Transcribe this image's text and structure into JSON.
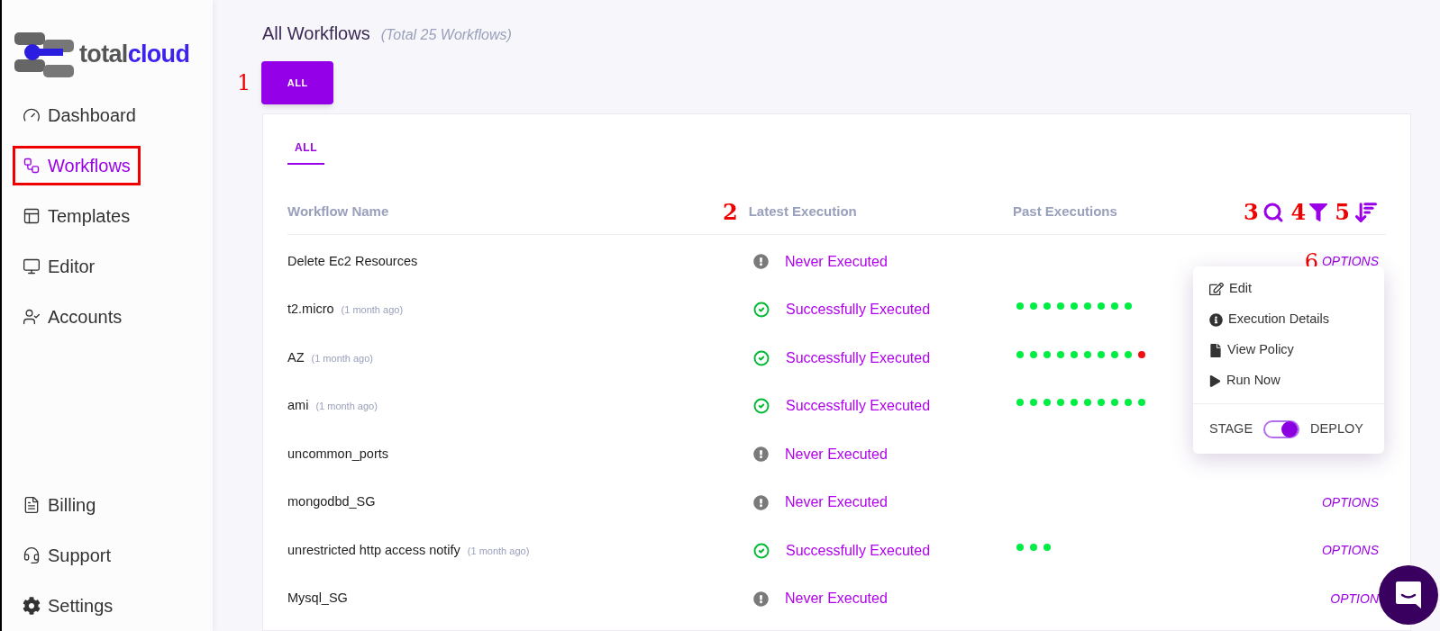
{
  "logo": {
    "part1": "total",
    "part2": "cloud"
  },
  "sidebar": {
    "items": [
      {
        "label": "Dashboard",
        "selected": false,
        "annotated": false
      },
      {
        "label": "Workflows",
        "selected": true,
        "annotated": true
      },
      {
        "label": "Templates",
        "selected": false,
        "annotated": false
      },
      {
        "label": "Editor",
        "selected": false,
        "annotated": false
      },
      {
        "label": "Accounts",
        "selected": false,
        "annotated": false
      }
    ],
    "bottom_items": [
      {
        "label": "Billing",
        "selected": false,
        "annotated": false
      },
      {
        "label": "Support",
        "selected": false,
        "annotated": false
      },
      {
        "label": "Settings",
        "selected": false,
        "annotated": false
      }
    ]
  },
  "header": {
    "title": "All Workflows",
    "subtitle": "(Total 25 Workflows)"
  },
  "filter_button": {
    "label": "ALL",
    "annotation": "1"
  },
  "tabs": [
    {
      "label": "ALL",
      "selected": true
    }
  ],
  "table": {
    "columns": [
      {
        "label": "Workflow Name"
      },
      {
        "label": "Latest Execution",
        "annotation": "2"
      },
      {
        "label": "Past Executions"
      }
    ],
    "tools": [
      {
        "kind": "search",
        "annotation": "3"
      },
      {
        "kind": "filter",
        "annotation": "4"
      },
      {
        "kind": "sort",
        "annotation": "5"
      }
    ],
    "rows": [
      {
        "name": "Delete Ec2 Resources",
        "kind": "never",
        "status_text": "Never Executed",
        "options": "OPTIONS",
        "annotation": "6"
      },
      {
        "name": "t2.micro",
        "age": "(1 month ago)",
        "kind": "success",
        "status_text": "Successfully Executed",
        "past": [
          {
            "color": "#00ee44"
          },
          {
            "color": "#00ee44"
          },
          {
            "color": "#00ee44"
          },
          {
            "color": "#00ee44"
          },
          {
            "color": "#00ee44"
          },
          {
            "color": "#00ee44"
          },
          {
            "color": "#00ee44"
          },
          {
            "color": "#00ee44"
          },
          {
            "color": "#00ee44"
          }
        ]
      },
      {
        "name": "AZ",
        "age": "(1 month ago)",
        "kind": "success",
        "status_text": "Successfully Executed",
        "past": [
          {
            "color": "#00ee44"
          },
          {
            "color": "#00ee44"
          },
          {
            "color": "#00ee44"
          },
          {
            "color": "#00ee44"
          },
          {
            "color": "#00ee44"
          },
          {
            "color": "#00ee44"
          },
          {
            "color": "#00ee44"
          },
          {
            "color": "#00ee44"
          },
          {
            "color": "#00ee44"
          },
          {
            "color": "#ee1111"
          }
        ]
      },
      {
        "name": "ami",
        "age": "(1 month ago)",
        "kind": "success",
        "status_text": "Successfully Executed",
        "past": [
          {
            "color": "#00ee44"
          },
          {
            "color": "#00ee44"
          },
          {
            "color": "#00ee44"
          },
          {
            "color": "#00ee44"
          },
          {
            "color": "#00ee44"
          },
          {
            "color": "#00ee44"
          },
          {
            "color": "#00ee44"
          },
          {
            "color": "#00ee44"
          },
          {
            "color": "#00ee44"
          },
          {
            "color": "#00ee44"
          }
        ]
      },
      {
        "name": "uncommon_ports",
        "kind": "never",
        "status_text": "Never Executed"
      },
      {
        "name": "mongodbd_SG",
        "kind": "never",
        "status_text": "Never Executed",
        "options": "OPTIONS"
      },
      {
        "name": "unrestricted http access notify",
        "age": "(1 month ago)",
        "kind": "success",
        "status_text": "Successfully Executed",
        "past": [
          {
            "color": "#00ee44"
          },
          {
            "color": "#00ee44"
          },
          {
            "color": "#00ee44"
          }
        ],
        "options": "OPTIONS"
      },
      {
        "name": "Mysql_SG",
        "kind": "never",
        "status_text": "Never Executed",
        "options": "OPTION"
      }
    ]
  },
  "options_menu": {
    "items": [
      {
        "kind": "edit",
        "label": "Edit"
      },
      {
        "kind": "info",
        "label": "Execution Details"
      },
      {
        "kind": "file",
        "label": "View Policy"
      },
      {
        "kind": "play",
        "label": "Run Now"
      }
    ],
    "toggle": {
      "left": "STAGE",
      "right": "DEPLOY",
      "on": true
    }
  }
}
